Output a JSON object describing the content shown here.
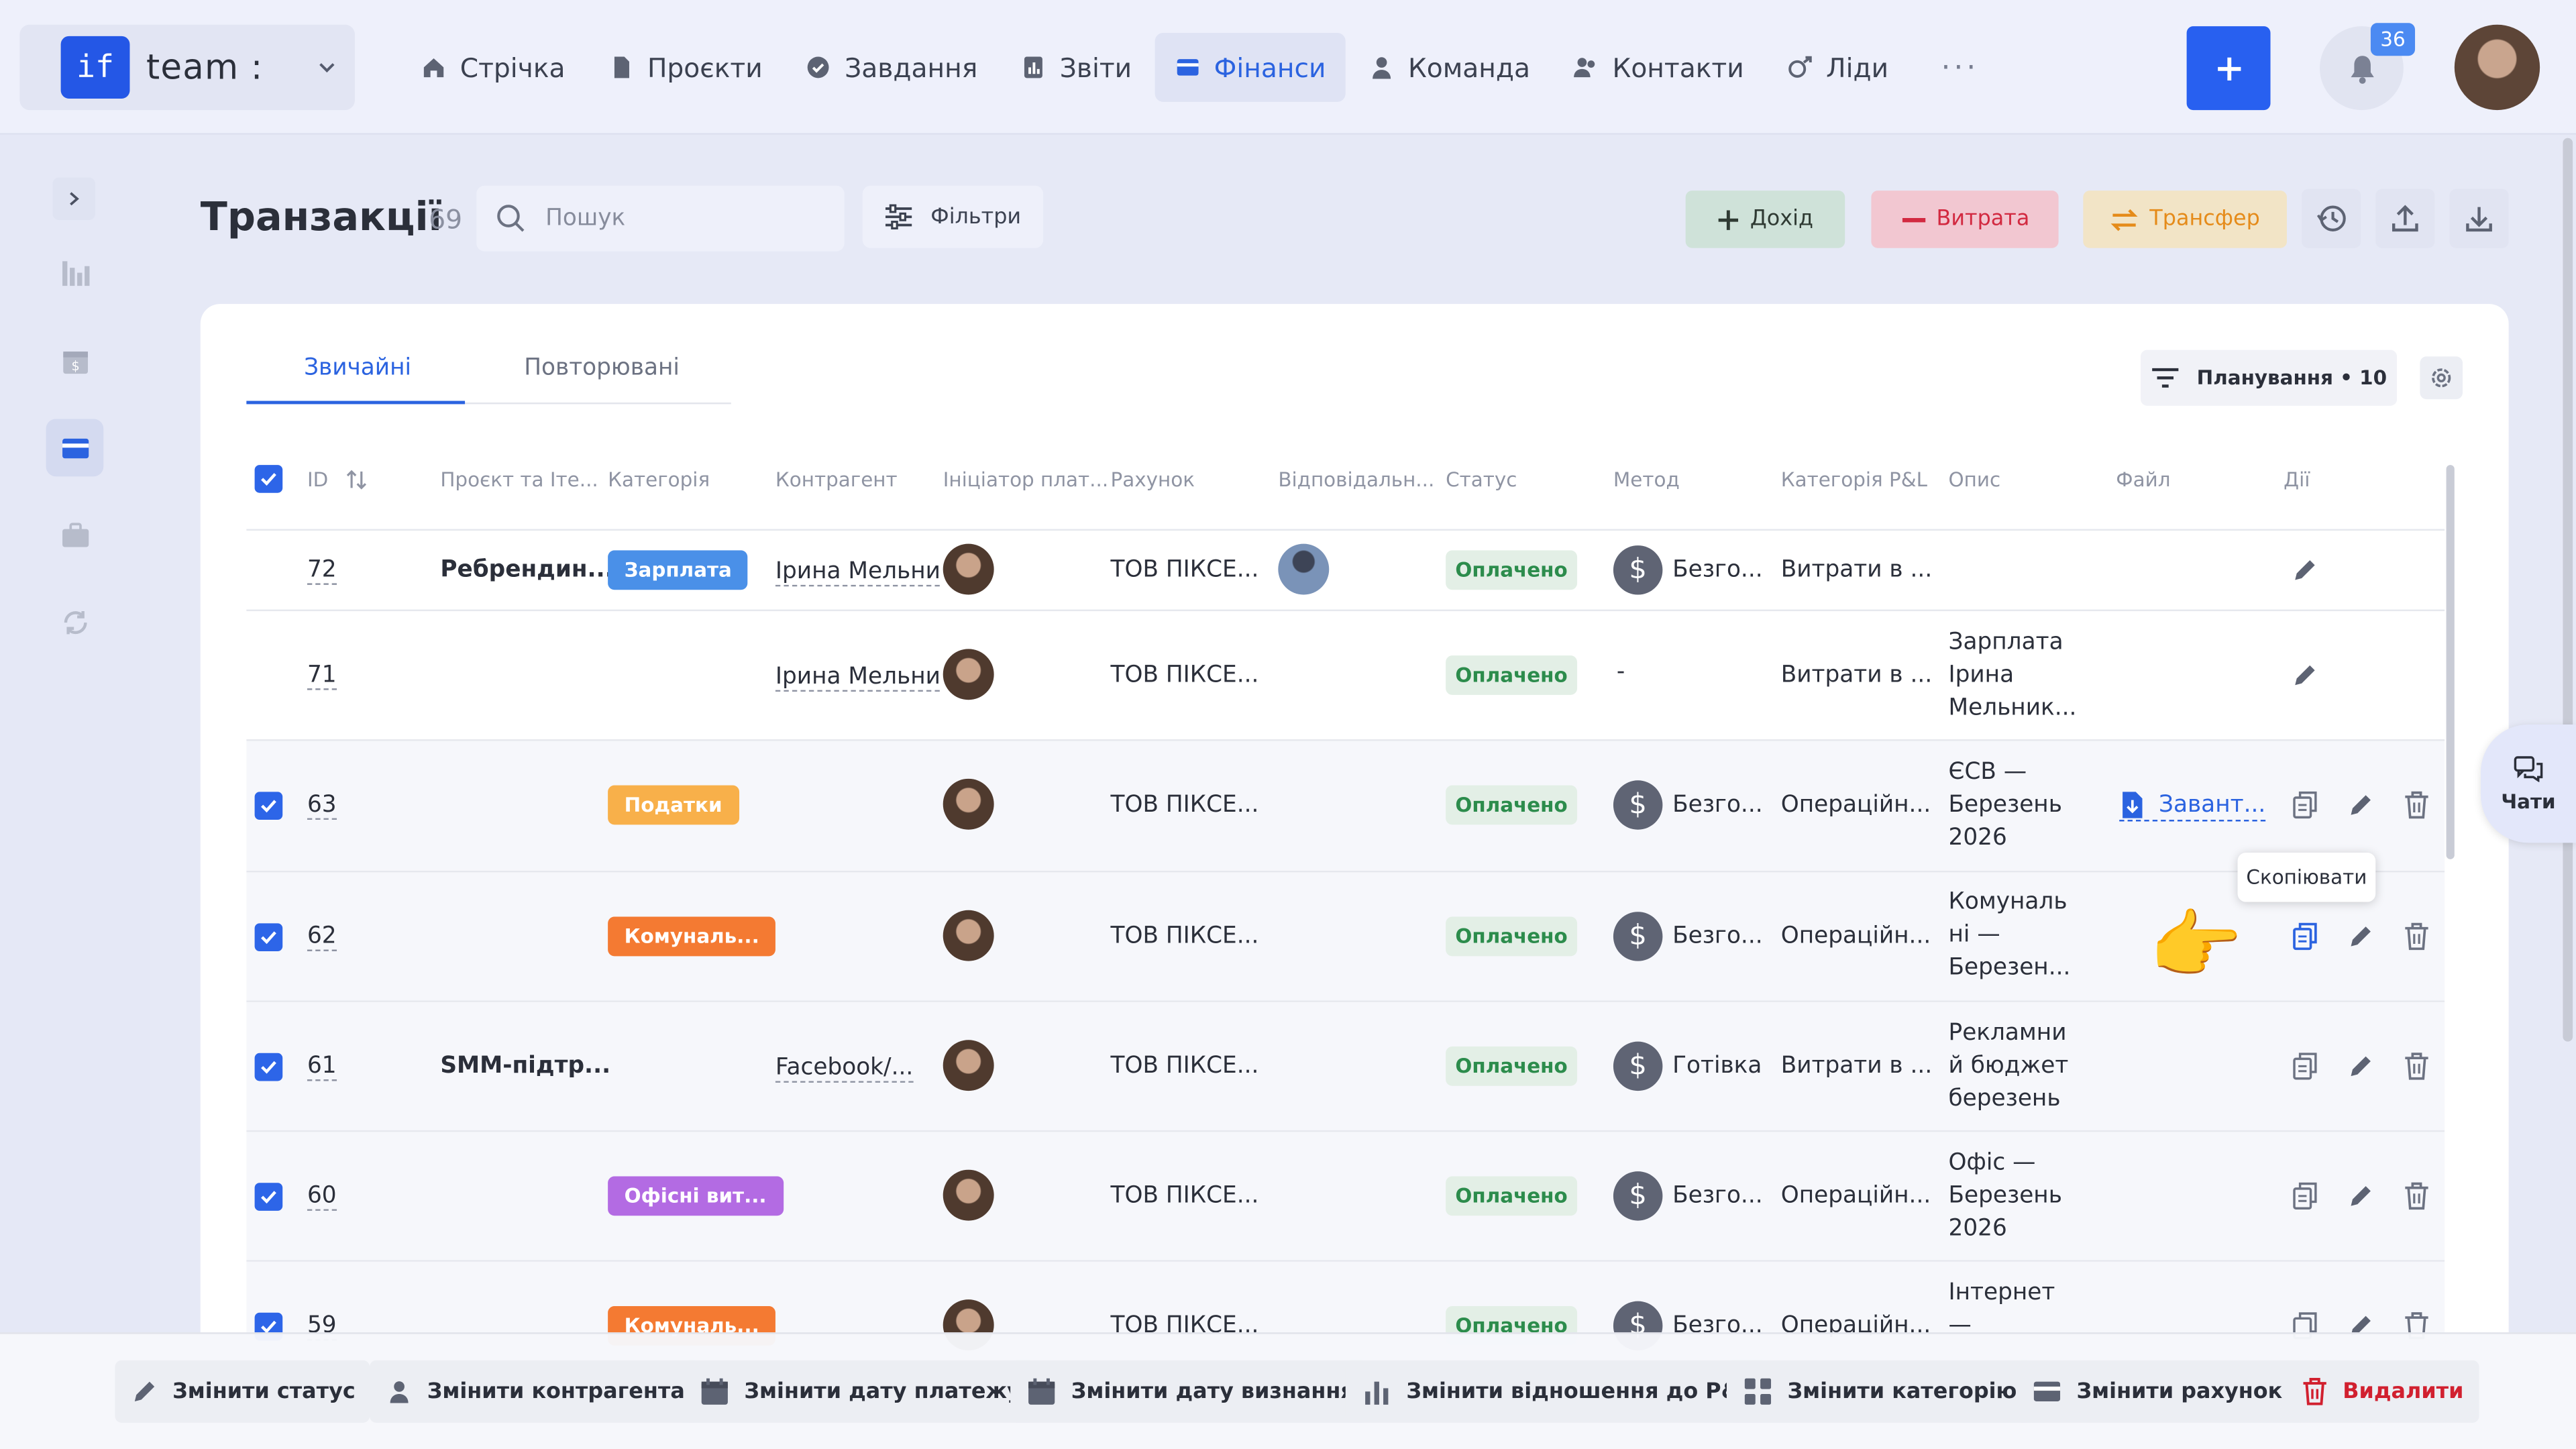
{
  "brand": {
    "logo_text": "if",
    "name": "team :"
  },
  "nav": [
    {
      "label": "Стрічка",
      "icon": "home-icon"
    },
    {
      "label": "Проєкти",
      "icon": "document-icon"
    },
    {
      "label": "Завдання",
      "icon": "check-circle-icon"
    },
    {
      "label": "Звіти",
      "icon": "report-icon"
    },
    {
      "label": "Фінанси",
      "icon": "wallet-icon",
      "active": true
    },
    {
      "label": "Команда",
      "icon": "person-icon"
    },
    {
      "label": "Контакти",
      "icon": "contacts-icon"
    },
    {
      "label": "Ліди",
      "icon": "leads-icon"
    }
  ],
  "nav_more": "···",
  "notifications_count": "36",
  "page": {
    "title": "Транзакції",
    "count": "69"
  },
  "search": {
    "placeholder": "Пошук"
  },
  "filters_label": "Фільтри",
  "actions": {
    "income": "Дохід",
    "expense": "Витрата",
    "transfer": "Трансфер"
  },
  "tabs": [
    "Звичайні",
    "Повторювані"
  ],
  "planning_label": "Планування • 10",
  "columns": [
    "ID",
    "Проєкт та Іте...",
    "Категорія",
    "Контрагент",
    "Ініціатор плат...",
    "Рахунок",
    "Відповідальн...",
    "Статус",
    "Метод",
    "Категорія P&L",
    "Опис",
    "Файл",
    "Дії"
  ],
  "rows": [
    {
      "id": "72",
      "checked": false,
      "project": "Ребрендин...",
      "category": "Зарплата",
      "category_color": "#4a90e8",
      "contractor": "Ірина Мельни",
      "account": "ТОВ ПІКСЕ...",
      "responsible": true,
      "status": "Оплачено",
      "method": "Безго...",
      "pl": "Витрати в ...",
      "desc": "",
      "file": "",
      "actions": [
        "edit"
      ]
    },
    {
      "id": "71",
      "checked": false,
      "project": "",
      "category": "",
      "contractor": "Ірина Мельни",
      "account": "ТОВ ПІКСЕ...",
      "responsible": false,
      "status": "Оплачено",
      "method": "-",
      "pl": "Витрати в ...",
      "desc": "Зарплата Ірина Мельник...",
      "file": "",
      "actions": [
        "edit"
      ]
    },
    {
      "id": "63",
      "checked": true,
      "project": "",
      "category": "Податки",
      "category_color": "#f8b04a",
      "contractor": "",
      "account": "ТОВ ПІКСЕ...",
      "responsible": false,
      "status": "Оплачено",
      "method": "Безго...",
      "pl": "Операційн...",
      "desc": "ЄСВ — Березень 2026",
      "file": "Завант...",
      "actions": [
        "copy",
        "edit",
        "delete"
      ]
    },
    {
      "id": "62",
      "checked": true,
      "project": "",
      "category": "Комуналь...",
      "category_color": "#f47a32",
      "contractor": "",
      "account": "ТОВ ПІКСЕ...",
      "responsible": false,
      "status": "Оплачено",
      "method": "Безго...",
      "pl": "Операційн...",
      "desc": "Комуналь ні — Березен...",
      "file": "",
      "actions": [
        "copy",
        "edit",
        "delete"
      ]
    },
    {
      "id": "61",
      "checked": true,
      "project": "SMM-підтр...",
      "category": "",
      "contractor": "Facebook/...",
      "account": "ТОВ ПІКСЕ...",
      "responsible": false,
      "status": "Оплачено",
      "method": "Готівка",
      "pl": "Витрати в ...",
      "desc": "Рекламни й бюджет березень",
      "file": "",
      "actions": [
        "copy",
        "edit",
        "delete"
      ]
    },
    {
      "id": "60",
      "checked": true,
      "project": "",
      "category": "Офісні вит...",
      "category_color": "#b36be3",
      "contractor": "",
      "account": "ТОВ ПІКСЕ...",
      "responsible": false,
      "status": "Оплачено",
      "method": "Безго...",
      "pl": "Операційн...",
      "desc": "Офіс — Березень 2026",
      "file": "",
      "actions": [
        "copy",
        "edit",
        "delete"
      ]
    },
    {
      "id": "59",
      "checked": true,
      "project": "",
      "category": "Комуналь...",
      "category_color": "#f47a32",
      "contractor": "",
      "account": "ТОВ ПІКСЕ...",
      "responsible": false,
      "status": "Оплачено",
      "method": "Безго...",
      "pl": "Операційн...",
      "desc": "Інтернет —",
      "file": "",
      "actions": [
        "copy",
        "edit",
        "delete"
      ]
    }
  ],
  "tooltip": "Скопіювати",
  "chats_label": "Чати",
  "bulk_actions": [
    {
      "label": "Змінити статус",
      "icon": "pencil-icon"
    },
    {
      "label": "Змінити контрагента",
      "icon": "person-icon"
    },
    {
      "label": "Змінити дату платежу",
      "icon": "calendar-icon"
    },
    {
      "label": "Змінити дату визнання",
      "icon": "calendar-icon"
    },
    {
      "label": "Змінити відношення до P&L",
      "icon": "bar-chart-icon"
    },
    {
      "label": "Змінити категорію",
      "icon": "grid-icon"
    },
    {
      "label": "Змінити рахунок",
      "icon": "card-icon"
    },
    {
      "label": "Видалити",
      "icon": "trash-icon"
    }
  ]
}
